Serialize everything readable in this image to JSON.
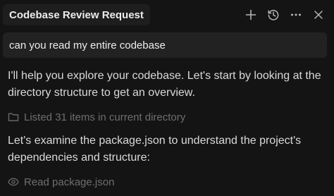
{
  "header": {
    "title": "Codebase Review Request",
    "icons": [
      "plus-icon",
      "history-icon",
      "more-icon",
      "close-icon"
    ]
  },
  "query": {
    "text": "can you read my entire codebase"
  },
  "messages": {
    "intro": "I'll help you explore your codebase. Let's start by looking at the directory structure to get an overview.",
    "tool_list": "Listed 31 items in current directory",
    "followup": "Let's examine the package.json to understand the project's dependencies and structure:",
    "tool_read": "Read package.json"
  },
  "colors": {
    "background": "#141414",
    "text": "#dadada",
    "muted": "#6e6e6e",
    "icon": "#b5b5b5"
  }
}
